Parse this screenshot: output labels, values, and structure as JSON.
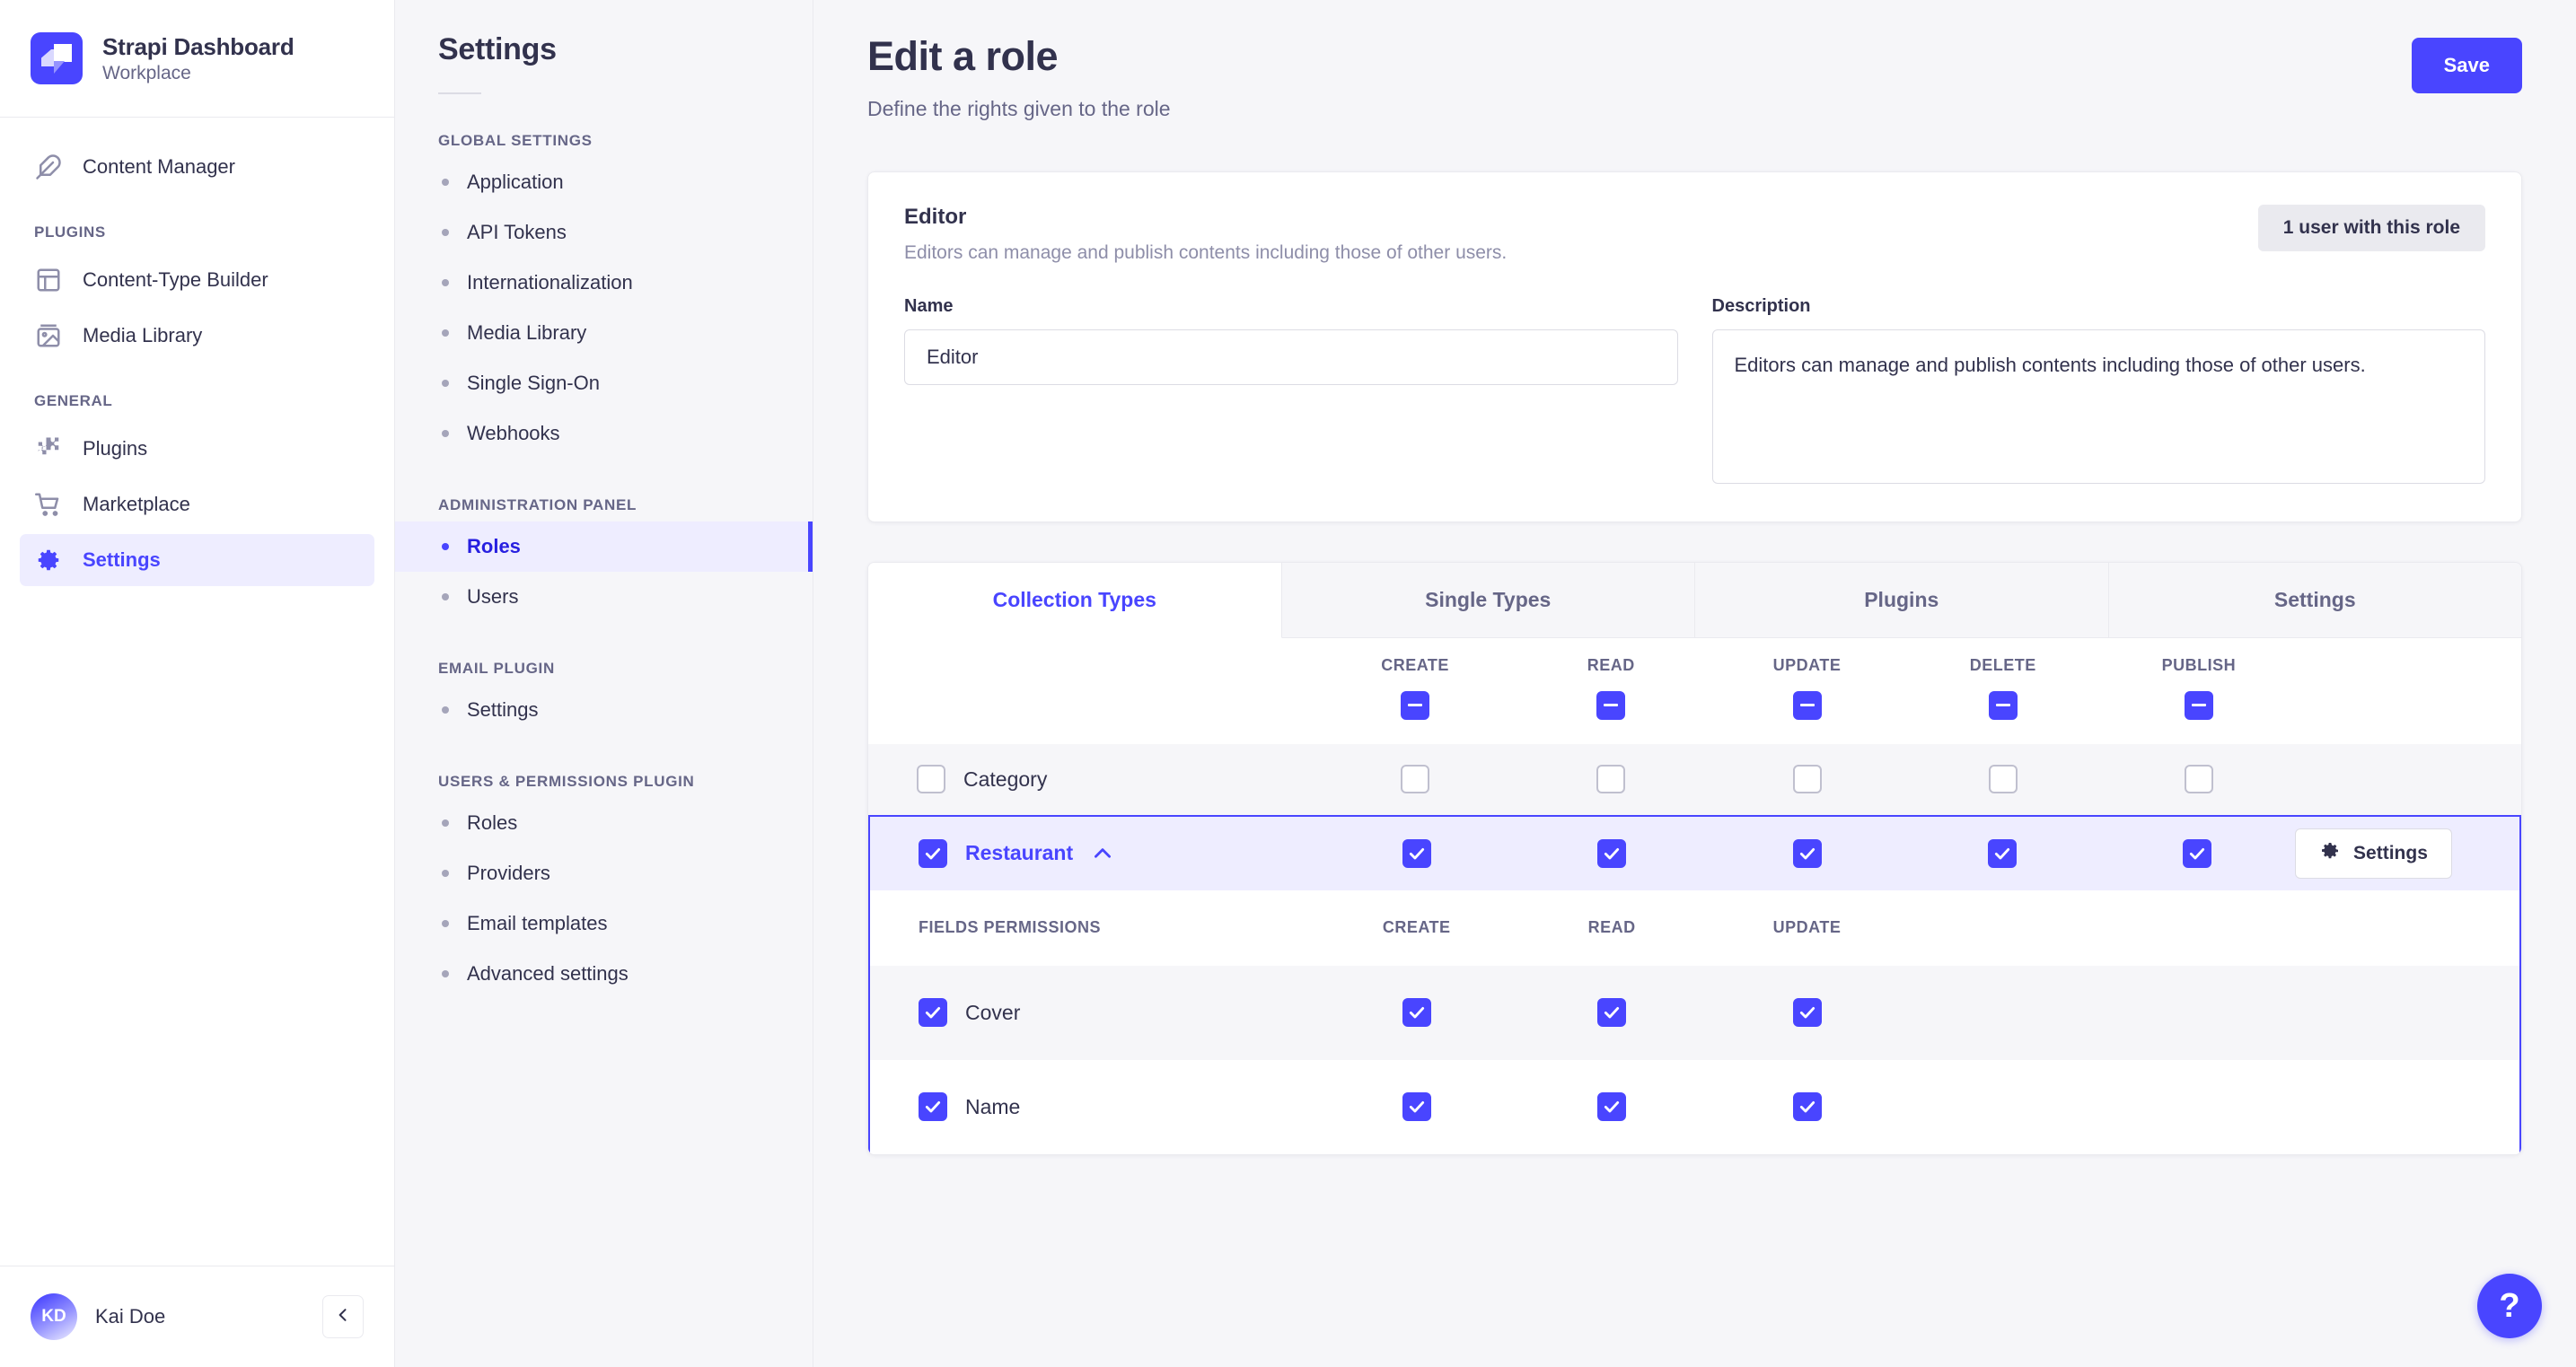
{
  "colors": {
    "brand": "#4945ff",
    "brand_dark": "#271fe0",
    "surface": "#ffffff",
    "background": "#f6f6f9",
    "neutral_text": "#32324d",
    "muted_text": "#666687",
    "border": "#eaeaef",
    "selected_row": "#eeedff"
  },
  "sidebar": {
    "brand_title": "Strapi Dashboard",
    "brand_subtitle": "Workplace",
    "brand_logo_icon": "strapi-logo-icon",
    "primary_items": [
      {
        "label": "Content Manager",
        "icon": "feather-icon",
        "active": false
      }
    ],
    "sections": [
      {
        "label": "PLUGINS",
        "items": [
          {
            "label": "Content-Type Builder",
            "icon": "layout-icon",
            "active": false
          },
          {
            "label": "Media Library",
            "icon": "image-icon",
            "active": false
          }
        ]
      },
      {
        "label": "GENERAL",
        "items": [
          {
            "label": "Plugins",
            "icon": "puzzle-icon",
            "active": false
          },
          {
            "label": "Marketplace",
            "icon": "shopping-cart-icon",
            "active": false
          },
          {
            "label": "Settings",
            "icon": "gear-icon",
            "active": true
          }
        ]
      }
    ],
    "footer": {
      "avatar_initials": "KD",
      "user_name": "Kai Doe",
      "collapse_icon": "chevron-left-icon"
    }
  },
  "subnav": {
    "title": "Settings",
    "sections": [
      {
        "label": "GLOBAL SETTINGS",
        "items": [
          {
            "label": "Application",
            "active": false
          },
          {
            "label": "API Tokens",
            "active": false
          },
          {
            "label": "Internationalization",
            "active": false
          },
          {
            "label": "Media Library",
            "active": false
          },
          {
            "label": "Single Sign-On",
            "active": false
          },
          {
            "label": "Webhooks",
            "active": false
          }
        ]
      },
      {
        "label": "ADMINISTRATION PANEL",
        "items": [
          {
            "label": "Roles",
            "active": true
          },
          {
            "label": "Users",
            "active": false
          }
        ]
      },
      {
        "label": "EMAIL PLUGIN",
        "items": [
          {
            "label": "Settings",
            "active": false
          }
        ]
      },
      {
        "label": "USERS & PERMISSIONS PLUGIN",
        "items": [
          {
            "label": "Roles",
            "active": false
          },
          {
            "label": "Providers",
            "active": false
          },
          {
            "label": "Email templates",
            "active": false
          },
          {
            "label": "Advanced settings",
            "active": false
          }
        ]
      }
    ]
  },
  "header": {
    "title": "Edit a role",
    "subtitle": "Define the rights given to the role",
    "save_label": "Save"
  },
  "role_card": {
    "name_heading": "Editor",
    "description_text": "Editors can manage and publish contents including those of other users.",
    "user_count_label": "1 user with this role",
    "name_field": {
      "label": "Name",
      "value": "Editor",
      "placeholder": "Name"
    },
    "description_field": {
      "label": "Description",
      "value": "Editors can manage and publish contents including those of other users.",
      "placeholder": "Description"
    }
  },
  "permissions": {
    "tabs": [
      {
        "label": "Collection Types",
        "active": true
      },
      {
        "label": "Single Types",
        "active": false
      },
      {
        "label": "Plugins",
        "active": false
      },
      {
        "label": "Settings",
        "active": false
      }
    ],
    "columns": [
      {
        "label": "CREATE",
        "state": "indeterminate"
      },
      {
        "label": "READ",
        "state": "indeterminate"
      },
      {
        "label": "UPDATE",
        "state": "indeterminate"
      },
      {
        "label": "DELETE",
        "state": "indeterminate"
      },
      {
        "label": "PUBLISH",
        "state": "indeterminate"
      }
    ],
    "rows": [
      {
        "label": "Category",
        "state": "unchecked",
        "selected": false,
        "cells": [
          "unchecked",
          "unchecked",
          "unchecked",
          "unchecked",
          "unchecked"
        ]
      },
      {
        "label": "Restaurant",
        "state": "checked",
        "selected": true,
        "expand_icon": "chevron-up-icon",
        "settings_button_label": "Settings",
        "settings_button_icon": "gear-icon",
        "cells": [
          "checked",
          "checked",
          "checked",
          "checked",
          "checked"
        ]
      }
    ],
    "fields_section": {
      "label": "FIELDS PERMISSIONS",
      "columns": [
        "CREATE",
        "READ",
        "UPDATE"
      ],
      "rows": [
        {
          "label": "Cover",
          "state": "checked",
          "cells": [
            "checked",
            "checked",
            "checked"
          ]
        },
        {
          "label": "Name",
          "state": "checked",
          "cells": [
            "checked",
            "checked",
            "checked"
          ]
        }
      ]
    }
  },
  "help": {
    "label": "?",
    "icon": "question-mark-icon"
  }
}
